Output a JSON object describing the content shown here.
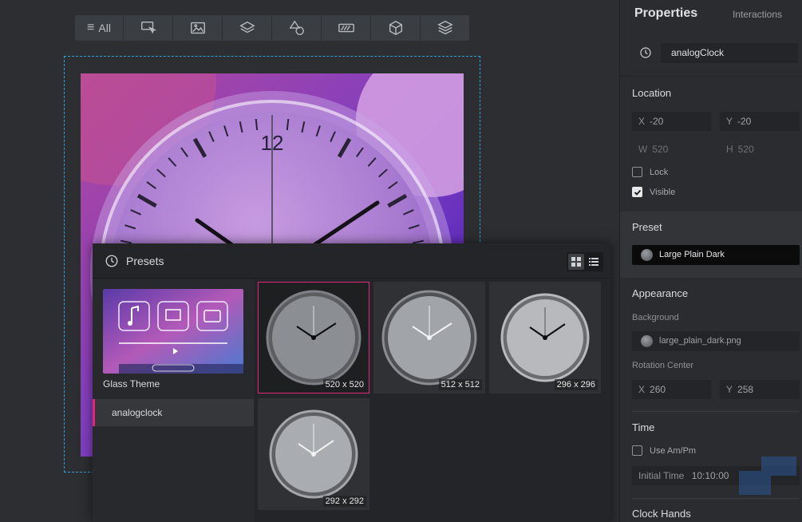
{
  "toolbar": {
    "all_label": "All",
    "icons": [
      "cursor-icon",
      "image-icon",
      "layers-icon",
      "shapes-icon",
      "progress-icon",
      "cube-icon",
      "stack-icon"
    ]
  },
  "canvas": {
    "clock_numeral": "12"
  },
  "presets": {
    "title": "Presets",
    "theme_label": "Glass Theme",
    "list_item": "analogclock",
    "tiles": [
      {
        "size": "520 x 520",
        "selected": true
      },
      {
        "size": "512 x 512",
        "selected": false
      },
      {
        "size": "296 x 296",
        "selected": false
      },
      {
        "size": "292 x 292",
        "selected": false
      }
    ]
  },
  "props": {
    "tab_properties": "Properties",
    "tab_interactions": "Interactions",
    "name": "analogClock",
    "location": {
      "title": "Location",
      "x": "-20",
      "y": "-20",
      "w": "520",
      "h": "520",
      "x_label": "X",
      "y_label": "Y",
      "w_label": "W",
      "h_label": "H",
      "lock": "Lock",
      "visible": "Visible"
    },
    "preset": {
      "title": "Preset",
      "value": "Large Plain Dark"
    },
    "appearance": {
      "title": "Appearance",
      "background_label": "Background",
      "background_value": "large_plain_dark.png",
      "rotation_label": "Rotation Center",
      "rx_label": "X",
      "rx": "260",
      "ry_label": "Y",
      "ry": "258"
    },
    "time": {
      "title": "Time",
      "ampm": "Use Am/Pm",
      "initial_label": "Initial Time",
      "initial_value": "10:10:00"
    },
    "clock_hands": {
      "title": "Clock Hands"
    }
  }
}
